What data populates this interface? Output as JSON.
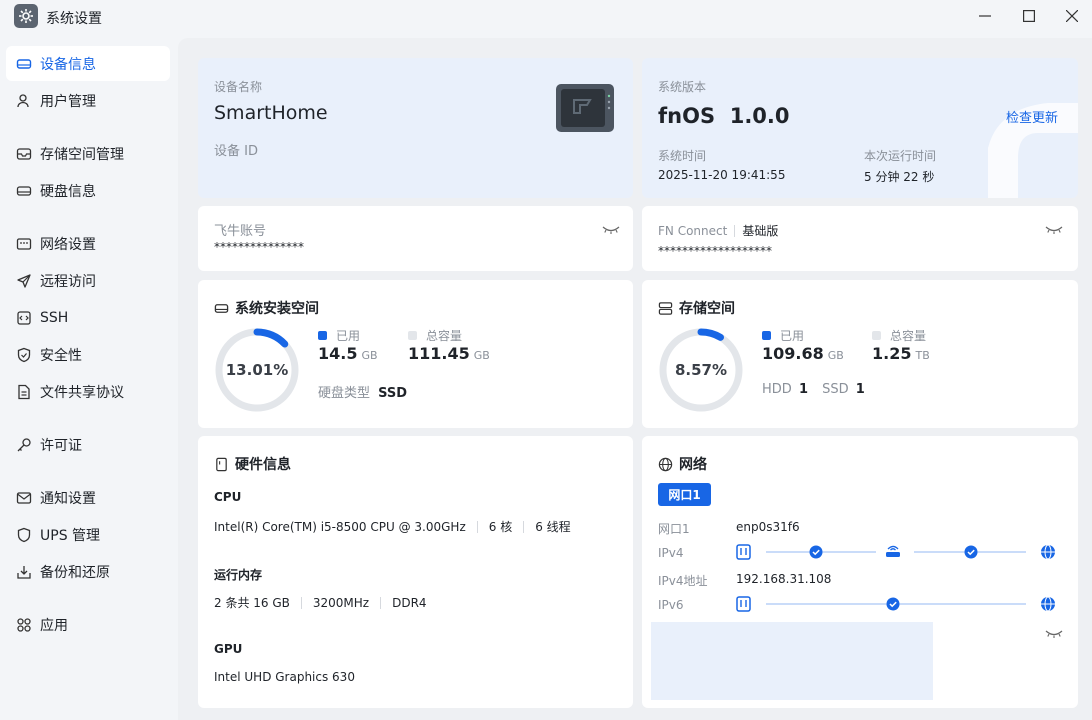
{
  "window": {
    "title": "系统设置",
    "controls": {
      "minimize": "minimize-icon",
      "maximize": "maximize-icon",
      "close": "close-icon"
    }
  },
  "sidebar": {
    "items": [
      {
        "label": "设备信息",
        "icon": "device-icon",
        "active": true
      },
      {
        "label": "用户管理",
        "icon": "user-icon"
      },
      {
        "label": "存储空间管理",
        "icon": "storage-icon"
      },
      {
        "label": "硬盘信息",
        "icon": "disk-icon"
      },
      {
        "label": "网络设置",
        "icon": "network-icon"
      },
      {
        "label": "远程访问",
        "icon": "send-icon"
      },
      {
        "label": "SSH",
        "icon": "ssh-icon"
      },
      {
        "label": "安全性",
        "icon": "shield-icon"
      },
      {
        "label": "文件共享协议",
        "icon": "file-icon"
      },
      {
        "label": "许可证",
        "icon": "key-icon"
      },
      {
        "label": "通知设置",
        "icon": "mail-icon"
      },
      {
        "label": "UPS 管理",
        "icon": "ups-icon"
      },
      {
        "label": "备份和还原",
        "icon": "backup-icon"
      },
      {
        "label": "应用",
        "icon": "apps-icon"
      }
    ]
  },
  "device": {
    "name_label": "设备名称",
    "name": "SmartHome",
    "id_label": "设备 ID"
  },
  "system": {
    "version_label": "系统版本",
    "os_name": "fnOS",
    "version": "1.0.0",
    "check_update": "检查更新",
    "time_label": "系统时间",
    "time": "2025-11-20 19:41:55",
    "uptime_label": "本次运行时间",
    "uptime": "5 分钟 22 秒"
  },
  "account": {
    "label": "飞牛账号",
    "masked": "***************"
  },
  "fnconnect": {
    "label": "FN Connect",
    "plan": "基础版",
    "masked": "*******************"
  },
  "install_space": {
    "title": "系统安装空间",
    "percent": "13.01%",
    "fraction": 0.1301,
    "used_label": "已用",
    "used_value": "14.5",
    "used_unit": "GB",
    "total_label": "总容量",
    "total_value": "111.45",
    "total_unit": "GB",
    "disk_type_label": "硬盘类型",
    "disk_type": "SSD"
  },
  "storage_space": {
    "title": "存储空间",
    "percent": "8.57%",
    "fraction": 0.0857,
    "used_label": "已用",
    "used_value": "109.68",
    "used_unit": "GB",
    "total_label": "总容量",
    "total_value": "1.25",
    "total_unit": "TB",
    "hdd_label": "HDD",
    "hdd_count": "1",
    "ssd_label": "SSD",
    "ssd_count": "1"
  },
  "hardware": {
    "title": "硬件信息",
    "cpu_label": "CPU",
    "cpu_model": "Intel(R) Core(TM) i5-8500 CPU @ 3.00GHz",
    "cpu_cores": "6 核",
    "cpu_threads": "6 线程",
    "mem_label": "运行内存",
    "mem_size": "2 条共 16 GB",
    "mem_speed": "3200MHz",
    "mem_type": "DDR4",
    "gpu_label": "GPU",
    "gpu_model": "Intel UHD Graphics 630"
  },
  "network": {
    "title": "网络",
    "tab": "网口1",
    "port_label": "网口1",
    "port_value": "enp0s31f6",
    "ipv4_label": "IPv4",
    "ipv4_addr_label": "IPv4地址",
    "ipv4_addr": "192.168.31.108",
    "ipv6_label": "IPv6"
  },
  "colors": {
    "accent": "#1866e5",
    "ring_track": "#e3e6ea",
    "card_blue": "#e9f0fb"
  }
}
